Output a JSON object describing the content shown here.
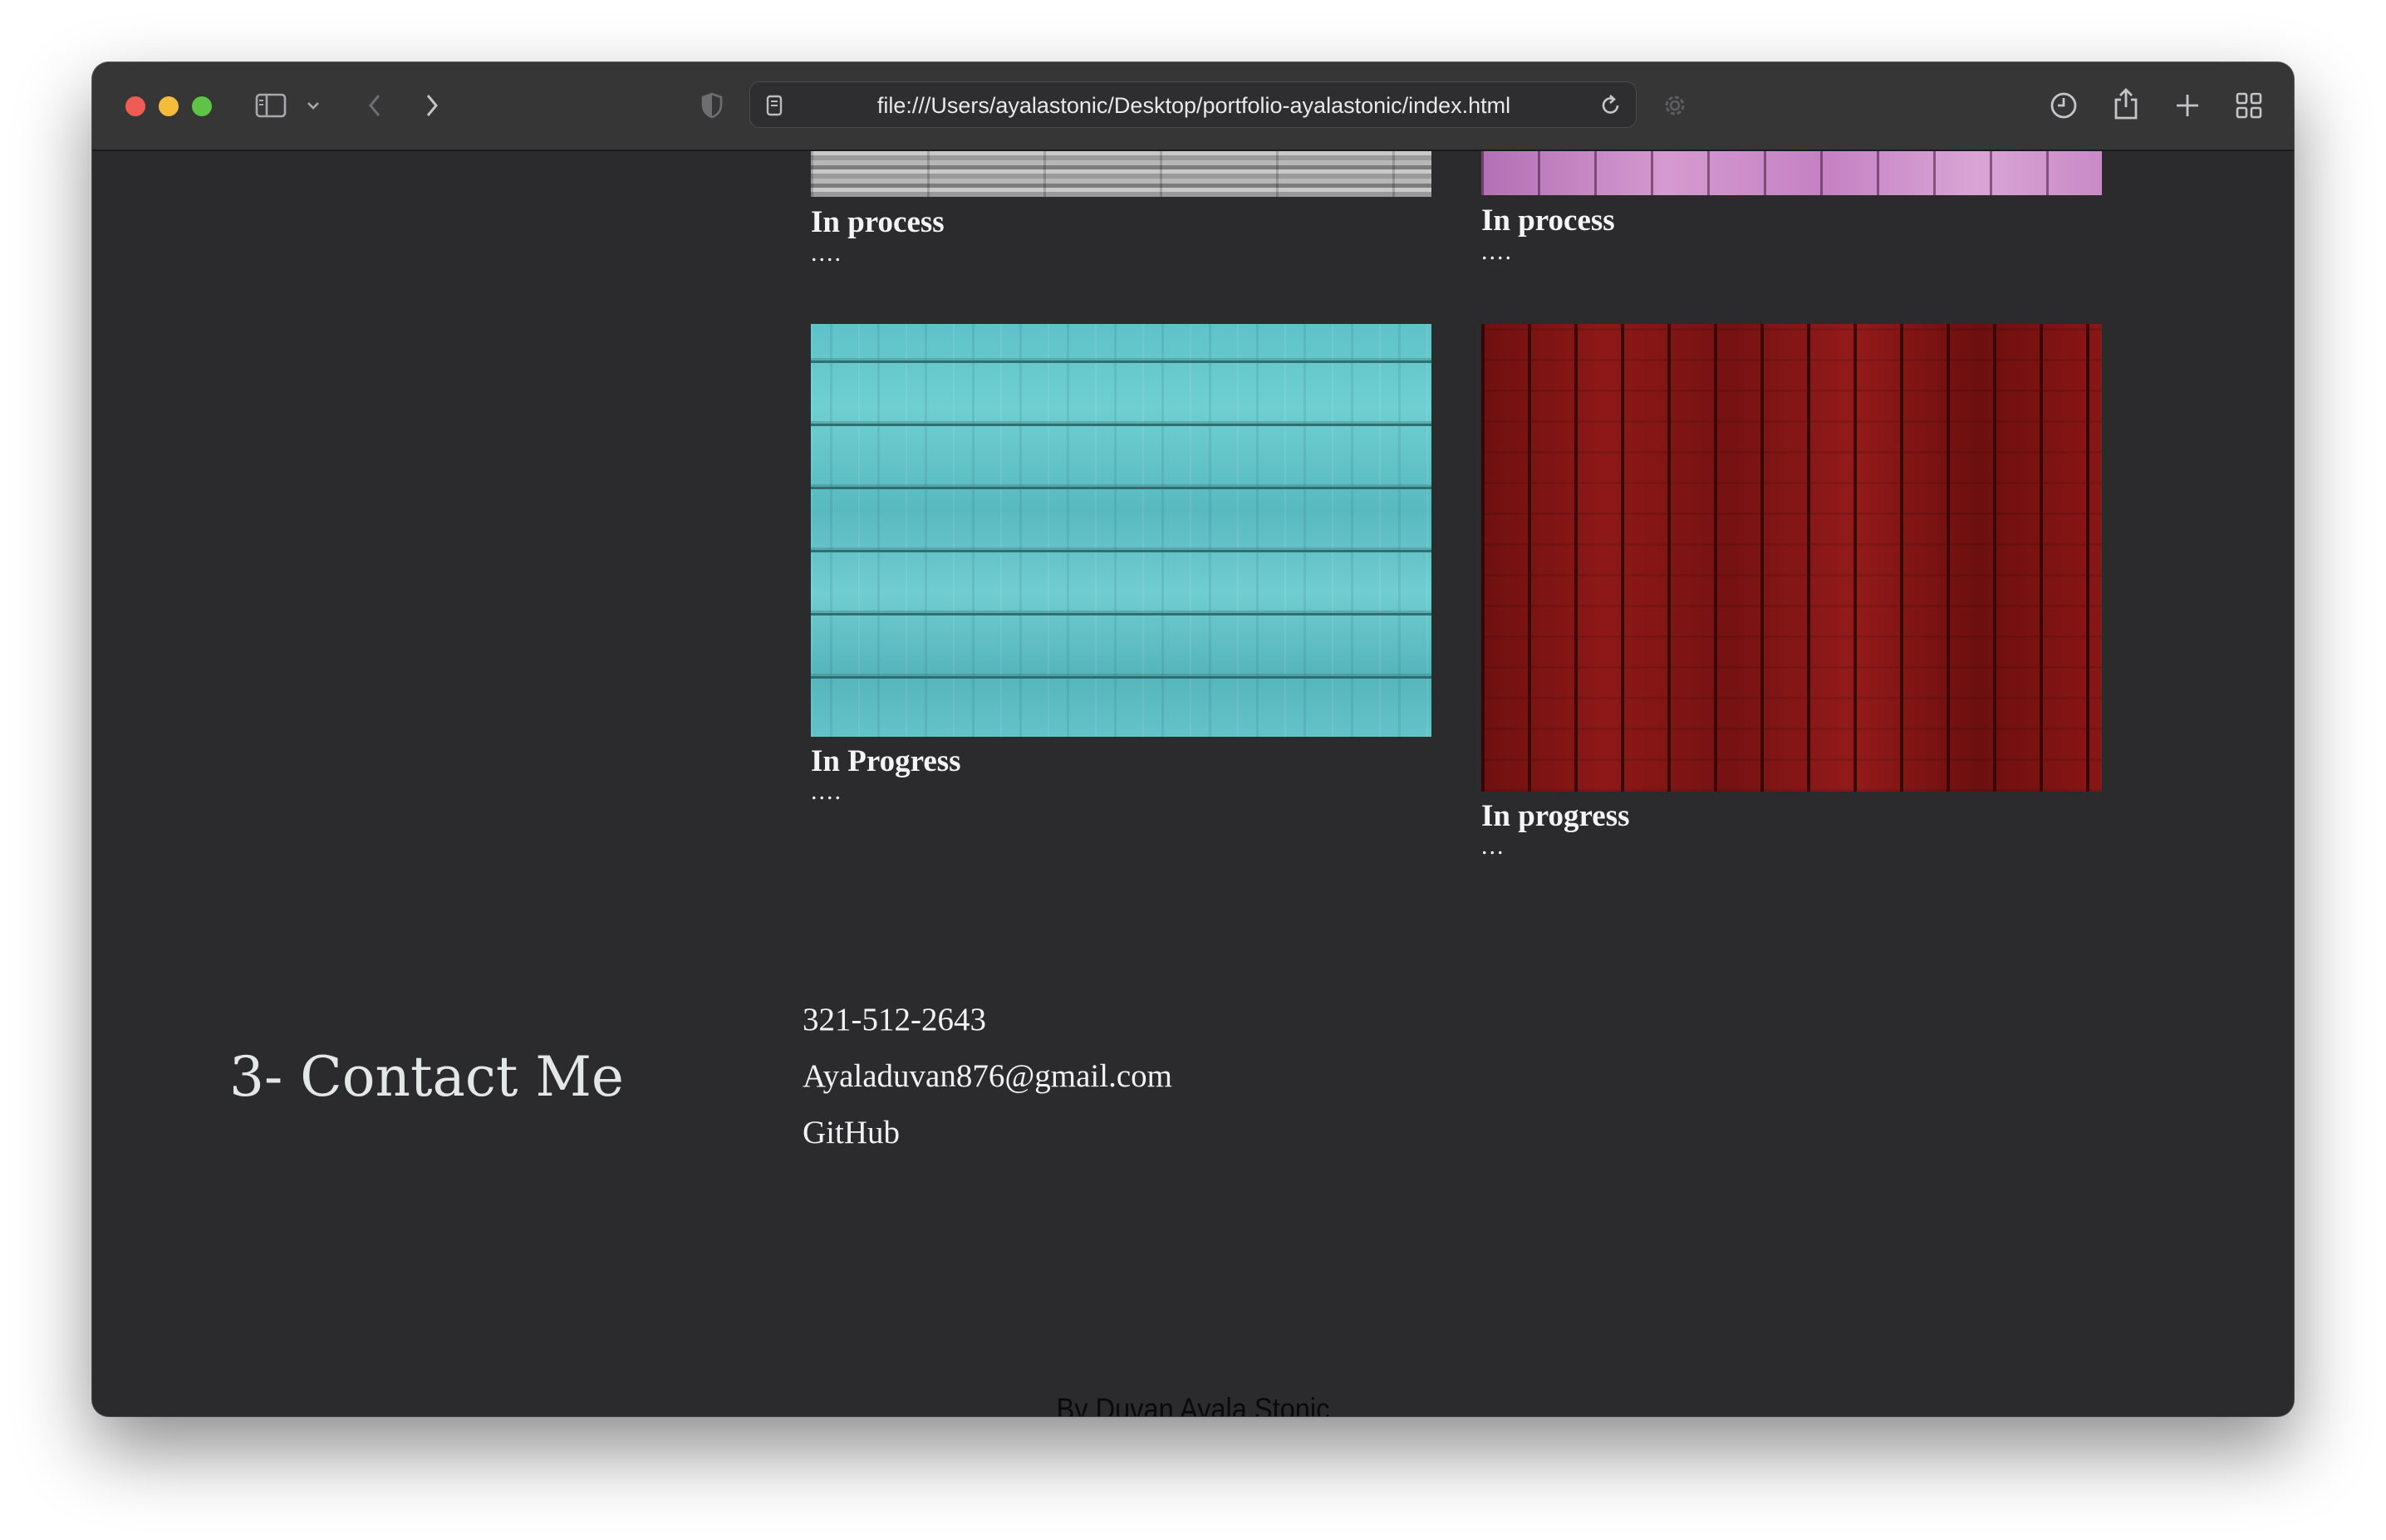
{
  "browser": {
    "url": "file:///Users/ayalastonic/Desktop/portfolio-ayalastonic/index.html"
  },
  "projects": [
    {
      "title": "In process",
      "description": "....",
      "texture": "gray-wood-planks"
    },
    {
      "title": "In process",
      "description": "....",
      "texture": "pink-wood-planks"
    },
    {
      "title": "In Progress",
      "description": "....",
      "texture": "turquoise-wood-planks"
    },
    {
      "title": "In progress",
      "description": "...",
      "texture": "red-wood-planks"
    }
  ],
  "contact": {
    "heading": "3- Contact Me",
    "phone": "321-512-2643",
    "email": "Ayaladuvan876@gmail.com",
    "github": "GitHub"
  },
  "footer": {
    "text": "By Duvan Ayala Stonic"
  },
  "colors": {
    "page_background": "#2b2a2c",
    "toolbar_background": "#373637",
    "text": "#f4f4f4",
    "heading": "#e3e8e6",
    "footer_text": "#0a0a0a"
  }
}
